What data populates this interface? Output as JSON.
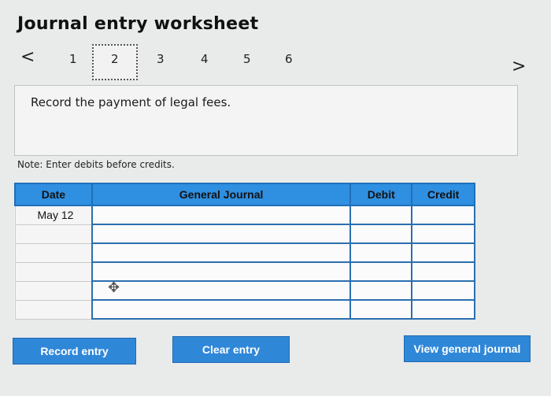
{
  "header": {
    "title": "Journal entry worksheet"
  },
  "nav": {
    "prev_icon": "chevron-left-icon",
    "next_icon": "chevron-right-icon",
    "prev_glyph": "<",
    "next_glyph": ">",
    "steps": [
      "1",
      "2",
      "3",
      "4",
      "5",
      "6"
    ],
    "active_step": "2"
  },
  "instruction": {
    "text": "Record the payment of legal fees."
  },
  "note": {
    "text": "Note: Enter debits before credits."
  },
  "table": {
    "headers": {
      "date": "Date",
      "journal": "General Journal",
      "debit": "Debit",
      "credit": "Credit"
    },
    "rows": [
      {
        "date": "May 12",
        "account": "",
        "debit": "",
        "credit": ""
      },
      {
        "date": "",
        "account": "",
        "debit": "",
        "credit": ""
      },
      {
        "date": "",
        "account": "",
        "debit": "",
        "credit": ""
      },
      {
        "date": "",
        "account": "",
        "debit": "",
        "credit": ""
      },
      {
        "date": "",
        "account": "",
        "debit": "",
        "credit": ""
      },
      {
        "date": "",
        "account": "",
        "debit": "",
        "credit": ""
      }
    ]
  },
  "buttons": {
    "record": "Record entry",
    "clear": "Clear entry",
    "view": "View general journal"
  },
  "colors": {
    "accent": "#2f87d8",
    "header_bg": "#2f8fe0",
    "background": "#e9eaea"
  }
}
